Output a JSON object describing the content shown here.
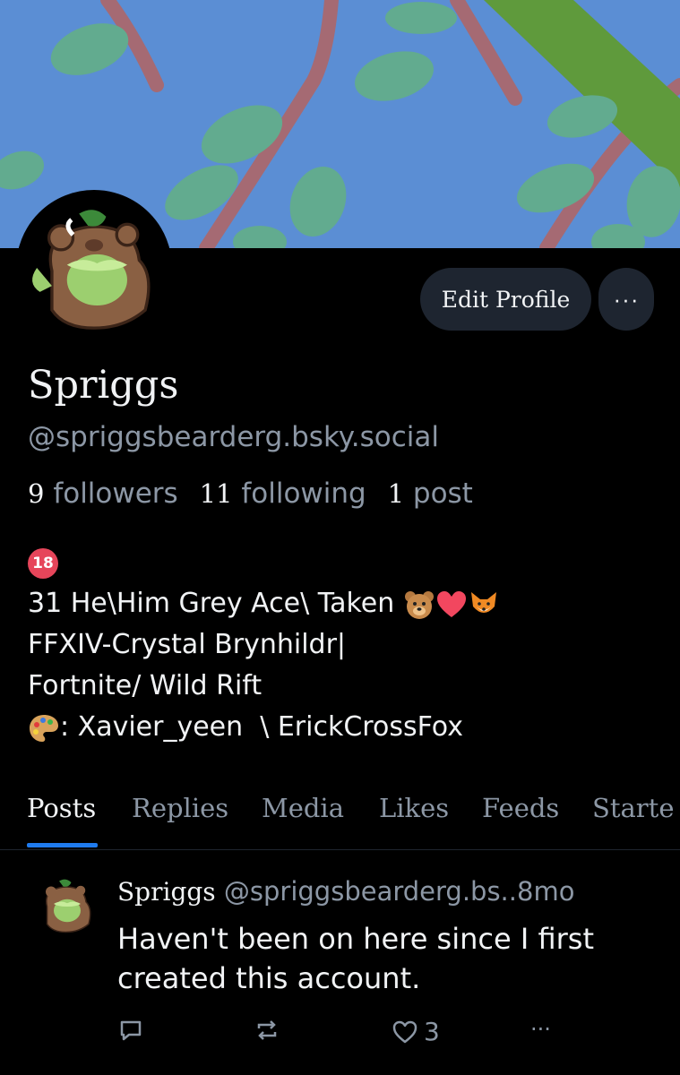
{
  "profile": {
    "display_name": "Spriggs",
    "handle": "@spriggsbearderg.bsky.social",
    "edit_label": "Edit Profile",
    "more_label": "···"
  },
  "stats": {
    "followers_count": "9",
    "followers_label": "followers",
    "following_count": "11",
    "following_label": "following",
    "posts_count": "1",
    "posts_label": "post"
  },
  "bio": {
    "badge": "18",
    "line1": "31 He\\Him Grey Ace\\ Taken ",
    "line2": "FFXIV-Crystal Brynhildr|",
    "line3": "Fortnite/ Wild Rift",
    "line4": ": Xavier_yeen  \\ ErickCrossFox"
  },
  "tabs": [
    {
      "label": "Posts"
    },
    {
      "label": "Replies"
    },
    {
      "label": "Media"
    },
    {
      "label": "Likes"
    },
    {
      "label": "Feeds"
    },
    {
      "label": "Starte"
    }
  ],
  "post": {
    "author": "Spriggs",
    "handle": "@spriggsbearderg.bs..",
    "time": "8mo",
    "text": "Haven't been on here since I first created this account.",
    "like_count": "3",
    "more_label": "···"
  },
  "colors": {
    "banner_sky": "#5b8ed4",
    "accent_blue": "#1f7bef",
    "muted_text": "#8c97a5",
    "button_bg": "#1e2530"
  },
  "icons": {
    "reply": "reply-icon",
    "repost": "repost-icon",
    "like": "heart-icon",
    "more": "more-dots-icon"
  }
}
